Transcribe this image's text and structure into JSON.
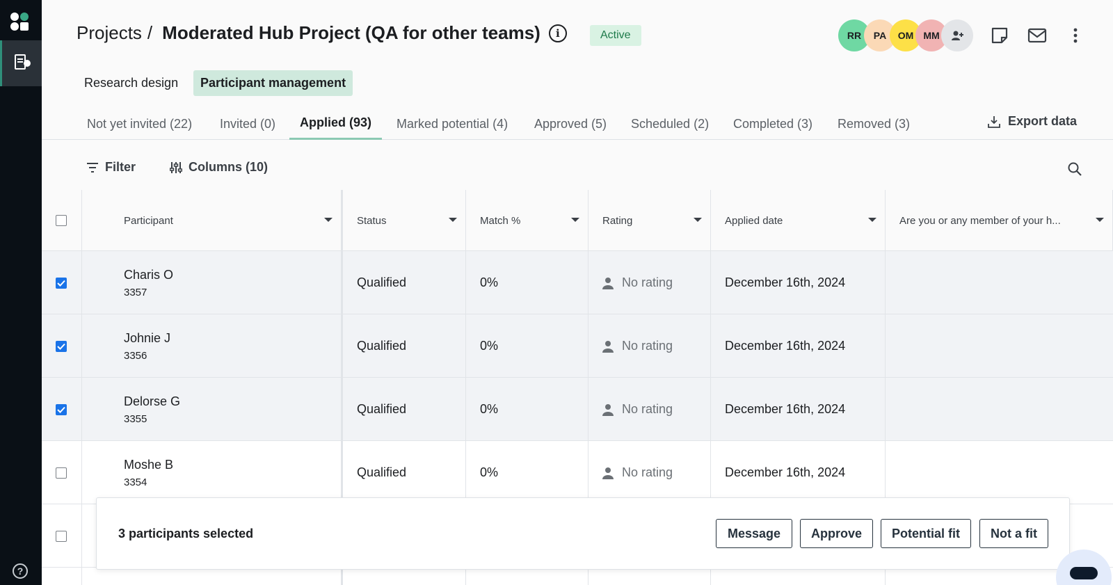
{
  "header": {
    "breadcrumb_root": "Projects",
    "breadcrumb_sep": "/",
    "title": "Moderated Hub Project (QA for other teams)",
    "status": "Active",
    "avatars": [
      {
        "initials": "RR",
        "color": "#6fd8a3"
      },
      {
        "initials": "PA",
        "color": "#fbd9b6"
      },
      {
        "initials": "OM",
        "color": "#fde047"
      },
      {
        "initials": "MM",
        "color": "#f1b3b3"
      }
    ],
    "icons": [
      "add-user-icon",
      "notes-icon",
      "mail-icon",
      "more-vertical-icon"
    ]
  },
  "top_tabs": [
    {
      "label": "Research design",
      "active": false
    },
    {
      "label": "Participant management",
      "active": true
    }
  ],
  "status_tabs": [
    {
      "label": "Not yet invited (22)",
      "active": false
    },
    {
      "label": "Invited (0)",
      "active": false
    },
    {
      "label": "Applied (93)",
      "active": true
    },
    {
      "label": "Marked potential (4)",
      "active": false
    },
    {
      "label": "Approved (5)",
      "active": false
    },
    {
      "label": "Scheduled (2)",
      "active": false
    },
    {
      "label": "Completed (3)",
      "active": false
    },
    {
      "label": "Removed (3)",
      "active": false
    }
  ],
  "export_label": "Export data",
  "toolbar": {
    "filter": "Filter",
    "columns": "Columns (10)"
  },
  "table": {
    "columns": [
      "Participant",
      "Status",
      "Match %",
      "Rating",
      "Applied date",
      "Are you or any member of your h..."
    ],
    "rows": [
      {
        "name": "Charis O",
        "id": "3357",
        "status": "Qualified",
        "match": "0%",
        "rating": "No rating",
        "date": "December 16th, 2024",
        "checked": true
      },
      {
        "name": "Johnie J",
        "id": "3356",
        "status": "Qualified",
        "match": "0%",
        "rating": "No rating",
        "date": "December 16th, 2024",
        "checked": true
      },
      {
        "name": "Delorse G",
        "id": "3355",
        "status": "Qualified",
        "match": "0%",
        "rating": "No rating",
        "date": "December 16th, 2024",
        "checked": true
      },
      {
        "name": "Moshe B",
        "id": "3354",
        "status": "Qualified",
        "match": "0%",
        "rating": "No rating",
        "date": "December 16th, 2024",
        "checked": false
      }
    ]
  },
  "selection_bar": {
    "count": "3 participants selected",
    "buttons": [
      "Message",
      "Approve",
      "Potential fit",
      "Not a fit"
    ]
  },
  "colors": {
    "accent": "#8cc9b3",
    "checkbox": "#1a73e8",
    "rail": "#0a1016"
  }
}
